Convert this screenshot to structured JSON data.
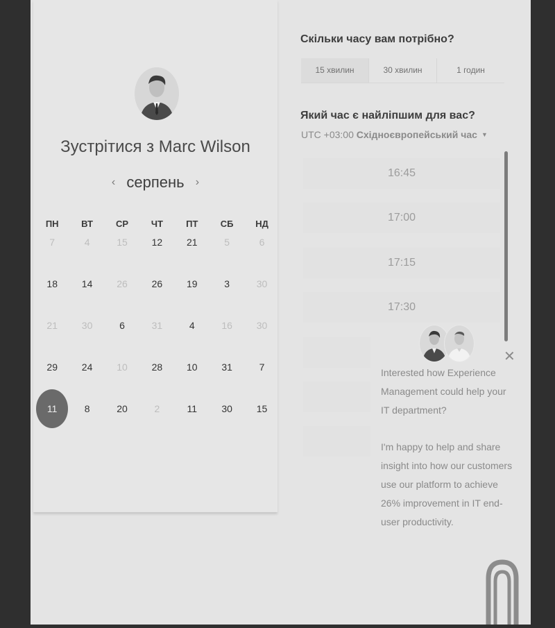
{
  "host": {
    "title": "Зустрітися з Marc Wilson"
  },
  "calendar": {
    "month": "серпень",
    "prev_icon": "chevron-left-icon",
    "next_icon": "chevron-right-icon",
    "weekdays": [
      "ПН",
      "ВТ",
      "СР",
      "ЧТ",
      "ПТ",
      "СБ",
      "НД"
    ],
    "weeks": [
      [
        {
          "d": "7",
          "off": true
        },
        {
          "d": "4",
          "off": true
        },
        {
          "d": "15",
          "off": true
        },
        {
          "d": "12",
          "off": false
        },
        {
          "d": "21",
          "off": false
        },
        {
          "d": "5",
          "off": true
        },
        {
          "d": "6",
          "off": true
        }
      ],
      [
        {
          "d": "18",
          "off": false
        },
        {
          "d": "14",
          "off": false
        },
        {
          "d": "26",
          "off": true
        },
        {
          "d": "26",
          "off": false
        },
        {
          "d": "19",
          "off": false
        },
        {
          "d": "3",
          "off": false
        },
        {
          "d": "30",
          "off": true
        }
      ],
      [
        {
          "d": "21",
          "off": true
        },
        {
          "d": "30",
          "off": true
        },
        {
          "d": "6",
          "off": false
        },
        {
          "d": "31",
          "off": true
        },
        {
          "d": "4",
          "off": false
        },
        {
          "d": "16",
          "off": true
        },
        {
          "d": "30",
          "off": true
        }
      ],
      [
        {
          "d": "29",
          "off": false
        },
        {
          "d": "24",
          "off": false
        },
        {
          "d": "10",
          "off": true
        },
        {
          "d": "28",
          "off": false
        },
        {
          "d": "10",
          "off": false
        },
        {
          "d": "31",
          "off": false
        },
        {
          "d": "7",
          "off": false
        }
      ],
      [
        {
          "d": "11",
          "off": false,
          "selected": true
        },
        {
          "d": "8",
          "off": false
        },
        {
          "d": "20",
          "off": false
        },
        {
          "d": "2",
          "off": true
        },
        {
          "d": "11",
          "off": false
        },
        {
          "d": "30",
          "off": false
        },
        {
          "d": "15",
          "off": false
        }
      ]
    ]
  },
  "duration": {
    "heading": "Скільки часу вам потрібно?",
    "options": [
      "15 хвилин",
      "30 хвилин",
      "1 годин"
    ],
    "selected": "15 хвилин"
  },
  "time": {
    "heading": "Який час є найліпшим для вас?",
    "tz_offset": "UTC +03:00",
    "tz_name": "Східноєвропейський час",
    "slots": [
      "16:45",
      "17:00",
      "17:15",
      "17:30"
    ]
  },
  "chat": {
    "line1": "Interested how Experience Management could help your IT department?",
    "line2": "I'm happy to help and share insight into how our customers use our platform to achieve 26% improvement in IT end-user productivity."
  },
  "colors": {
    "background": "#2f2f2f",
    "page": "#e4e4e4",
    "selected_day": "#6a6a6a"
  }
}
